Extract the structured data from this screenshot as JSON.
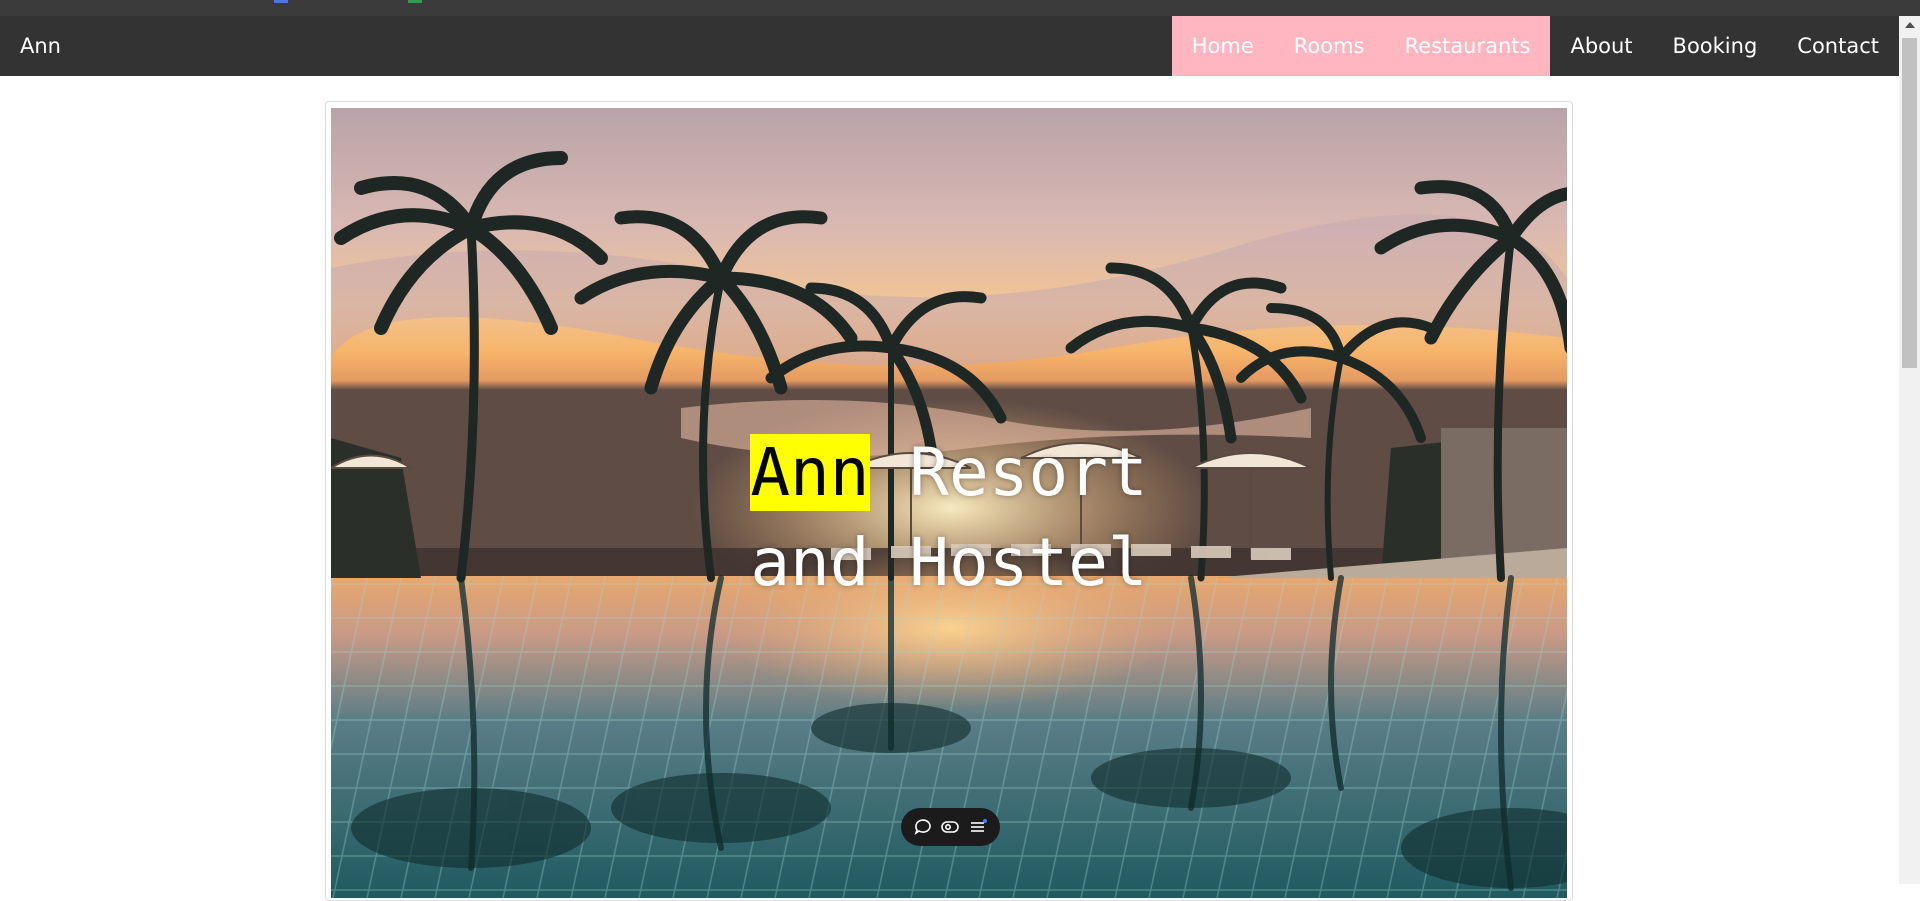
{
  "brand": "Ann",
  "nav": {
    "items": [
      {
        "label": "Home",
        "active": true
      },
      {
        "label": "Rooms",
        "active": true
      },
      {
        "label": "Restaurants",
        "active": true
      },
      {
        "label": "About",
        "active": false
      },
      {
        "label": "Booking",
        "active": false
      },
      {
        "label": "Contact",
        "active": false
      }
    ]
  },
  "hero": {
    "title_highlight": "Ann",
    "title_rest": " Resort",
    "title_line2": "and Hostel"
  },
  "toolbar": {
    "icons": [
      "comment-icon",
      "eye-icon",
      "menu-icon"
    ]
  },
  "colors": {
    "navbar": "#333333",
    "active_nav": "#ffb6c1",
    "highlight": "#ffff00"
  }
}
